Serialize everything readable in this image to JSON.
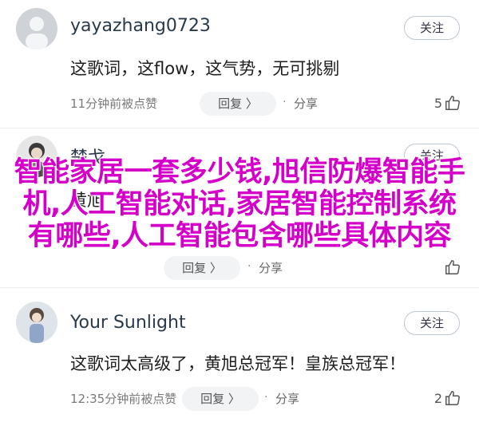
{
  "comments": [
    {
      "username": "yayazhang0723",
      "follow_label": "关注",
      "text": "这歌词，这flow，这气势，无可挑剔",
      "meta": "11分钟前被点赞",
      "reply_label": "回复 〉",
      "share_label": "分享",
      "likes": "5"
    },
    {
      "username": "楚戈",
      "follow_label": "关注",
      "text": "黄旭",
      "meta": "",
      "reply_label": "回复 〉",
      "share_label": "分享",
      "likes": ""
    },
    {
      "username": "Your Sunlight",
      "follow_label": "关注",
      "text": "这歌词太高级了，黄旭总冠军！皇族总冠军！",
      "meta": "12:35分钟前被点赞",
      "reply_label": "回复 〉",
      "share_label": "分享",
      "likes": "2"
    }
  ],
  "overlay_title": "智能家居一套多少钱,旭信防爆智能手机,人工智能对话,家居智能控制系统有哪些,人工智能包含哪些具体内容",
  "colors": {
    "overlay": "#d400c9",
    "username": "#2a3a4a",
    "reply_bg": "#f1f3f5"
  },
  "icons": [
    "avatar",
    "thumb-up-icon"
  ]
}
